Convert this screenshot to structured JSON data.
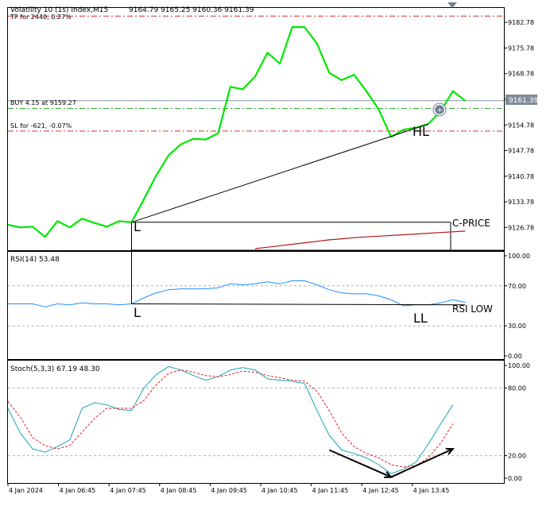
{
  "header": {
    "symbol": "Volatility 10 (1s) Index,M15",
    "ohlc": "9164.79 9165.25 9160.36 9161.39",
    "tp_label": "TP for 2440, 0.27%",
    "buy_label": "BUY 4.15 at 9159.27",
    "sl_label": "SL for -621, -0.07%"
  },
  "price_tag": "9161.39",
  "annotations": {
    "low1": "L",
    "hl": "HL",
    "c_price": "C-PRICE",
    "rsi_low1": "L",
    "ll": "LL",
    "rsi_low": "RSI LOW"
  },
  "indicators": {
    "rsi_title": "RSI(14) 53.48",
    "stoch_title": "Stoch(5,3,3) 67.19 48.30"
  },
  "colors": {
    "price_line": "#00e600",
    "rsi_line": "#1e90ff",
    "stoch_main": "#1aa3b8",
    "stoch_signal": "#e02020",
    "tp_sl_line": "#d03030",
    "buy_line": "#30b030",
    "ma_line": "#b01818"
  },
  "chart_data": [
    {
      "type": "line",
      "panel": "price",
      "x": [
        "4 Jan 2024",
        "4 Jan 06:45",
        "4 Jan 07:45",
        "4 Jan 08:45",
        "4 Jan 09:45",
        "4 Jan 10:45",
        "4 Jan 11:45",
        "4 Jan 12:45",
        "4 Jan 13:45"
      ],
      "yticks": [
        "9182.78",
        "9175.78",
        "9168.78",
        "9161.78",
        "9154.78",
        "9147.78",
        "9140.78",
        "9133.78",
        "9126.78"
      ],
      "ylim": [
        9121.0,
        9186.5
      ],
      "series": [
        {
          "values": [
            9127.5,
            9126.8,
            9127.0,
            9124.2,
            9128.5,
            9126.8,
            9129.2,
            9128.0,
            9127.0,
            9128.5,
            9128.2,
            9134.5,
            9141.0,
            9146.5,
            9149.5,
            9151.0,
            9150.8,
            9152.5,
            9165.2,
            9164.5,
            9168.0,
            9174.5,
            9171.5,
            9181.5,
            9181.5,
            9177.0,
            9169.0,
            9167.0,
            9168.5,
            9164.0,
            9159.0,
            9151.5,
            9153.5,
            9154.0,
            9155.0,
            9158.5,
            9164.0,
            9161.39
          ]
        },
        {
          "values": [
            null,
            null,
            null,
            null,
            null,
            null,
            null,
            null,
            null,
            null,
            null,
            null,
            null,
            null,
            null,
            null,
            null,
            null,
            null,
            null,
            9121.0,
            9121.4,
            9121.8,
            9122.2,
            9122.6,
            9123.0,
            9123.4,
            9123.7,
            9124.0,
            9124.2,
            9124.4,
            9124.6,
            9124.8,
            9125.0,
            9125.2,
            9125.4,
            9125.6,
            9125.8
          ]
        }
      ],
      "levels": {
        "tp": 9184.5,
        "buy": 9159.27,
        "sl": 9153.1,
        "current": 9161.39
      },
      "trendline": {
        "from_index": 10,
        "from_value": 9128.2,
        "to_index": 34,
        "to_value": 9155.0
      },
      "box": {
        "from_index": 10,
        "to_index": 37,
        "top": 9128.2,
        "bottom": 9118.0
      }
    },
    {
      "type": "line",
      "panel": "rsi",
      "yticks": [
        "100.00",
        "70.00",
        "30.00",
        "0.00"
      ],
      "ylim": [
        0,
        100
      ],
      "levels": [
        70,
        30
      ],
      "series": [
        {
          "values": [
            52,
            52,
            52,
            49,
            52,
            51,
            53,
            52,
            52,
            51,
            52,
            58,
            63,
            66,
            67,
            67,
            67,
            68,
            72,
            71,
            72,
            74,
            72,
            75,
            75,
            71,
            66,
            63,
            62,
            62,
            60,
            56,
            50,
            51,
            51,
            53,
            56,
            53.48
          ]
        }
      ],
      "trendline": {
        "from_index": 10,
        "from_value": 52,
        "to_index": 37,
        "to_value": 51
      }
    },
    {
      "type": "line",
      "panel": "stoch",
      "yticks": [
        "100.00",
        "80.00",
        "20.00",
        "0.00"
      ],
      "ylim": [
        0,
        100
      ],
      "levels": [
        80,
        20
      ],
      "series": [
        {
          "values": [
            62,
            40,
            26,
            23,
            28,
            34,
            62,
            67,
            65,
            61,
            60,
            80,
            92,
            99,
            96,
            91,
            87,
            90,
            96,
            98,
            96,
            88,
            87,
            86,
            84,
            60,
            38,
            25,
            22,
            18,
            12,
            4,
            8,
            14,
            30,
            48,
            65
          ]
        },
        {
          "values": [
            68,
            54,
            36,
            29,
            26,
            29,
            41,
            53,
            62,
            62,
            62,
            69,
            83,
            93,
            96,
            94,
            91,
            90,
            92,
            95,
            94,
            91,
            89,
            87,
            86,
            77,
            60,
            40,
            28,
            22,
            18,
            12,
            10,
            11,
            18,
            31,
            48.3
          ]
        }
      ],
      "arrows": [
        {
          "from_index": 26,
          "from_value": 25,
          "to_index": 31,
          "to_value": 1
        },
        {
          "from_index": 31,
          "from_value": 1,
          "to_index": 36,
          "to_value": 26
        }
      ]
    }
  ]
}
